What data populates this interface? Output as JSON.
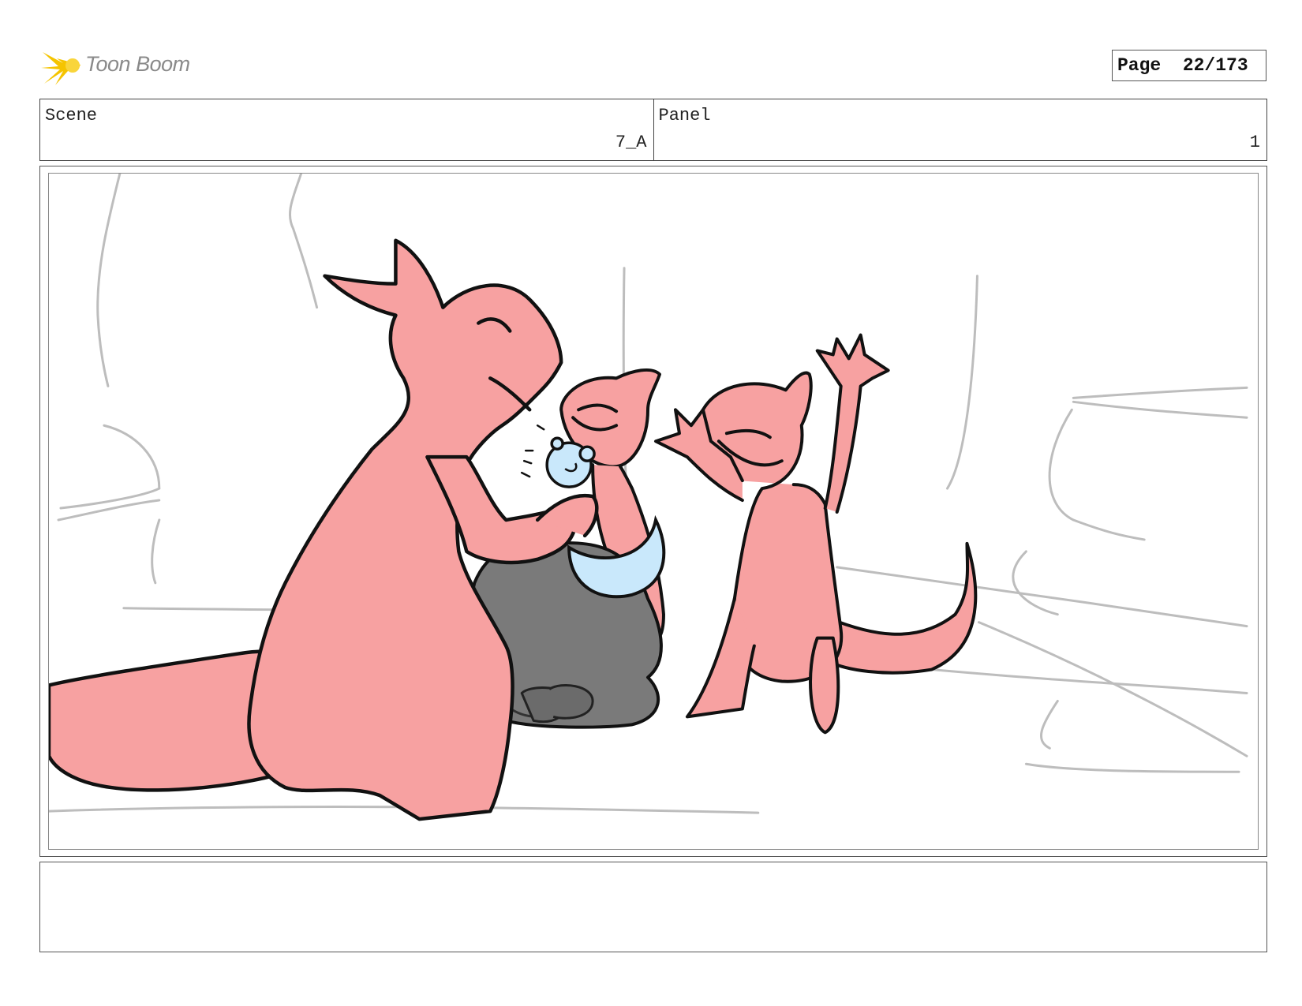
{
  "brand": {
    "name": "Toon Boom",
    "logo_icon": "starburst-icon",
    "accent": "#f5c400"
  },
  "page": {
    "text": "Page  22/173"
  },
  "header": {
    "scene": {
      "label": "Scene",
      "value": "7_A"
    },
    "panel": {
      "label": "Panel",
      "value": "1"
    }
  },
  "artwork": {
    "colors": {
      "character_fill": "#f7a1a1",
      "rock_fill": "#7a7a7a",
      "bib_fill": "#c9e8fb",
      "sketch_line": "#bdbdbd",
      "ink": "#111111"
    }
  },
  "notes": {
    "text": ""
  }
}
